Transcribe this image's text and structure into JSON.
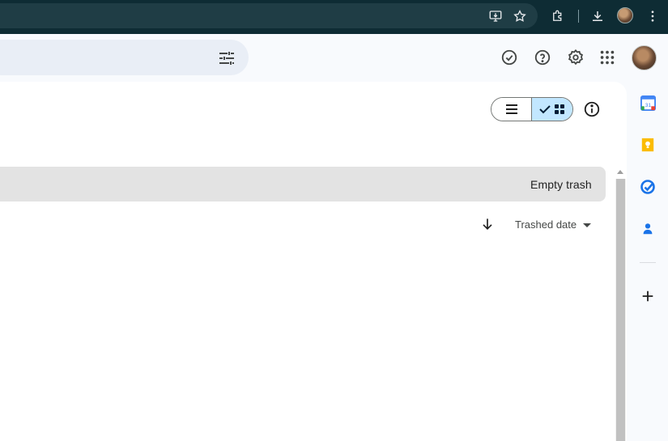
{
  "browser": {
    "icons": [
      "install-app-icon",
      "bookmark-star-icon",
      "extensions-icon",
      "downloads-icon",
      "profile-avatar",
      "more-menu-icon"
    ]
  },
  "header": {
    "icons": [
      "search-options-icon",
      "offline-ready-icon",
      "help-icon",
      "settings-icon",
      "apps-grid-icon",
      "account-avatar"
    ]
  },
  "toolbar": {
    "layout_options": [
      "list",
      "grid"
    ],
    "selected_layout": "grid",
    "info_icon": "info-icon"
  },
  "trash": {
    "empty_label": "Empty trash"
  },
  "sort": {
    "field_label": "Trashed date",
    "direction": "descending"
  },
  "side_panel": {
    "apps": [
      "calendar-icon",
      "keep-icon",
      "tasks-icon",
      "contacts-icon",
      "add-icon"
    ],
    "calendar_day": "31"
  },
  "colors": {
    "chrome_bar": "#0e2c34",
    "accent_selected": "#c2e7ff",
    "trash_bar": "#e3e3e3"
  }
}
